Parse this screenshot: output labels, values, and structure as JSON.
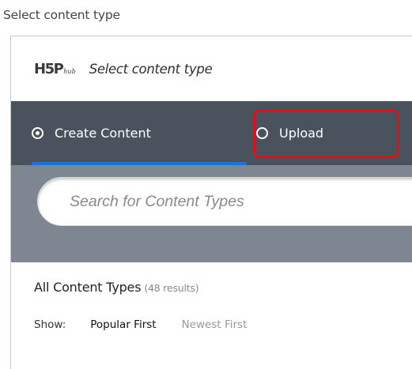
{
  "page": {
    "outer_label": "Select content type"
  },
  "hub": {
    "logo_main": "H5P",
    "logo_sub": "hub",
    "title": "Select content type"
  },
  "tabs": [
    {
      "label": "Create Content",
      "selected": true
    },
    {
      "label": "Upload",
      "selected": false,
      "highlighted": true
    }
  ],
  "search": {
    "placeholder": "Search for Content Types"
  },
  "results": {
    "heading": "All Content Types",
    "count_text": "(48 results)"
  },
  "sort": {
    "show_label": "Show:",
    "options": [
      "Popular First",
      "Newest First"
    ],
    "active": "Popular First"
  },
  "colors": {
    "tab_bar": "#4a525e",
    "search_band": "#7e8691",
    "active_tab_underline": "#1a73d9",
    "highlight": "#e0101a"
  }
}
